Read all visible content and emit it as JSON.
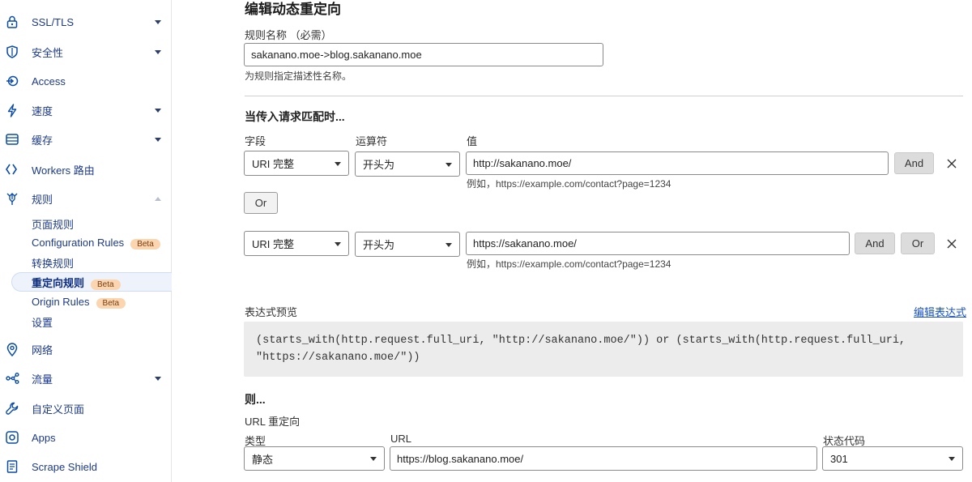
{
  "sidebar": {
    "items": [
      {
        "label": "SSL/TLS",
        "icon": "lock-icon",
        "has_caret": true
      },
      {
        "label": "安全性",
        "icon": "shield-icon",
        "has_caret": true
      },
      {
        "label": "Access",
        "icon": "access-icon",
        "has_caret": false
      },
      {
        "label": "速度",
        "icon": "lightning-icon",
        "has_caret": true
      },
      {
        "label": "缓存",
        "icon": "storage-icon",
        "has_caret": true
      },
      {
        "label": "Workers 路由",
        "icon": "workers-icon",
        "has_caret": false
      },
      {
        "label": "规则",
        "icon": "rules-icon",
        "has_caret": true,
        "expanded": true
      }
    ],
    "rules_sub": [
      {
        "label": "页面规则"
      },
      {
        "label": "Configuration Rules",
        "badge": "Beta"
      },
      {
        "label": "转换规则"
      },
      {
        "label": "重定向规则",
        "badge": "Beta",
        "active": true
      },
      {
        "label": "Origin Rules",
        "badge": "Beta"
      },
      {
        "label": "设置"
      }
    ],
    "items_after": [
      {
        "label": "网络",
        "icon": "location-pin-icon",
        "has_caret": false
      },
      {
        "label": "流量",
        "icon": "traffic-icon",
        "has_caret": true
      },
      {
        "label": "自定义页面",
        "icon": "wrench-icon",
        "has_caret": false
      },
      {
        "label": "Apps",
        "icon": "apps-icon",
        "has_caret": false
      },
      {
        "label": "Scrape Shield",
        "icon": "document-icon",
        "has_caret": false
      }
    ]
  },
  "page": {
    "title": "编辑动态重定向",
    "rule_name_label": "规则名称 （必需）",
    "rule_name_value": "sakanano.moe->blog.sakanano.moe",
    "rule_name_hint": "为规则指定描述性名称。",
    "when_heading": "当传入请求匹配时...",
    "field_label": "字段",
    "operator_label": "运算符",
    "value_label": "值",
    "conditions": [
      {
        "field": "URI 完整",
        "operator": "开头为",
        "value": "http://sakanano.moe/",
        "hint": "例如，https://example.com/contact?page=1234",
        "and_label": "And"
      },
      {
        "field": "URI 完整",
        "operator": "开头为",
        "value": "https://sakanano.moe/",
        "hint": "例如，https://example.com/contact?page=1234",
        "and_label": "And",
        "or_label": "Or"
      }
    ],
    "or_button_label": "Or",
    "expression_label": "表达式预览",
    "edit_expression_link": "编辑表达式",
    "expression_line1": "(starts_with(http.request.full_uri, \"http://sakanano.moe/\")) or (starts_with(http.request.full_uri,",
    "expression_line2": "\"https://sakanano.moe/\"))",
    "then_heading": "则...",
    "redirect_label": "URL 重定向",
    "type_label": "类型",
    "type_value": "静态",
    "url_label": "URL",
    "url_value": "https://blog.sakanano.moe/",
    "status_label": "状态代码",
    "status_value": "301"
  },
  "colors": {
    "nav_text": "#1d3a8a",
    "nav_icon": "#0a4ba8",
    "link": "#1b52c2",
    "beta_badge_bg": "#fbd5b0",
    "code_bg": "#ececec",
    "button_bg": "#dcdcdc"
  }
}
